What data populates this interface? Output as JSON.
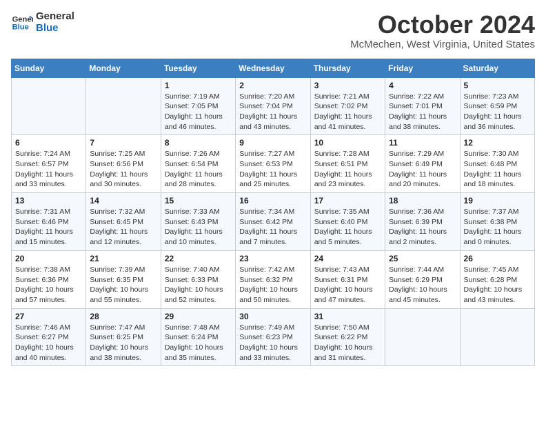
{
  "header": {
    "logo_line1": "General",
    "logo_line2": "Blue",
    "month": "October 2024",
    "location": "McMechen, West Virginia, United States"
  },
  "weekdays": [
    "Sunday",
    "Monday",
    "Tuesday",
    "Wednesday",
    "Thursday",
    "Friday",
    "Saturday"
  ],
  "weeks": [
    [
      {
        "day": "",
        "info": ""
      },
      {
        "day": "",
        "info": ""
      },
      {
        "day": "1",
        "info": "Sunrise: 7:19 AM\nSunset: 7:05 PM\nDaylight: 11 hours and 46 minutes."
      },
      {
        "day": "2",
        "info": "Sunrise: 7:20 AM\nSunset: 7:04 PM\nDaylight: 11 hours and 43 minutes."
      },
      {
        "day": "3",
        "info": "Sunrise: 7:21 AM\nSunset: 7:02 PM\nDaylight: 11 hours and 41 minutes."
      },
      {
        "day": "4",
        "info": "Sunrise: 7:22 AM\nSunset: 7:01 PM\nDaylight: 11 hours and 38 minutes."
      },
      {
        "day": "5",
        "info": "Sunrise: 7:23 AM\nSunset: 6:59 PM\nDaylight: 11 hours and 36 minutes."
      }
    ],
    [
      {
        "day": "6",
        "info": "Sunrise: 7:24 AM\nSunset: 6:57 PM\nDaylight: 11 hours and 33 minutes."
      },
      {
        "day": "7",
        "info": "Sunrise: 7:25 AM\nSunset: 6:56 PM\nDaylight: 11 hours and 30 minutes."
      },
      {
        "day": "8",
        "info": "Sunrise: 7:26 AM\nSunset: 6:54 PM\nDaylight: 11 hours and 28 minutes."
      },
      {
        "day": "9",
        "info": "Sunrise: 7:27 AM\nSunset: 6:53 PM\nDaylight: 11 hours and 25 minutes."
      },
      {
        "day": "10",
        "info": "Sunrise: 7:28 AM\nSunset: 6:51 PM\nDaylight: 11 hours and 23 minutes."
      },
      {
        "day": "11",
        "info": "Sunrise: 7:29 AM\nSunset: 6:49 PM\nDaylight: 11 hours and 20 minutes."
      },
      {
        "day": "12",
        "info": "Sunrise: 7:30 AM\nSunset: 6:48 PM\nDaylight: 11 hours and 18 minutes."
      }
    ],
    [
      {
        "day": "13",
        "info": "Sunrise: 7:31 AM\nSunset: 6:46 PM\nDaylight: 11 hours and 15 minutes."
      },
      {
        "day": "14",
        "info": "Sunrise: 7:32 AM\nSunset: 6:45 PM\nDaylight: 11 hours and 12 minutes."
      },
      {
        "day": "15",
        "info": "Sunrise: 7:33 AM\nSunset: 6:43 PM\nDaylight: 11 hours and 10 minutes."
      },
      {
        "day": "16",
        "info": "Sunrise: 7:34 AM\nSunset: 6:42 PM\nDaylight: 11 hours and 7 minutes."
      },
      {
        "day": "17",
        "info": "Sunrise: 7:35 AM\nSunset: 6:40 PM\nDaylight: 11 hours and 5 minutes."
      },
      {
        "day": "18",
        "info": "Sunrise: 7:36 AM\nSunset: 6:39 PM\nDaylight: 11 hours and 2 minutes."
      },
      {
        "day": "19",
        "info": "Sunrise: 7:37 AM\nSunset: 6:38 PM\nDaylight: 11 hours and 0 minutes."
      }
    ],
    [
      {
        "day": "20",
        "info": "Sunrise: 7:38 AM\nSunset: 6:36 PM\nDaylight: 10 hours and 57 minutes."
      },
      {
        "day": "21",
        "info": "Sunrise: 7:39 AM\nSunset: 6:35 PM\nDaylight: 10 hours and 55 minutes."
      },
      {
        "day": "22",
        "info": "Sunrise: 7:40 AM\nSunset: 6:33 PM\nDaylight: 10 hours and 52 minutes."
      },
      {
        "day": "23",
        "info": "Sunrise: 7:42 AM\nSunset: 6:32 PM\nDaylight: 10 hours and 50 minutes."
      },
      {
        "day": "24",
        "info": "Sunrise: 7:43 AM\nSunset: 6:31 PM\nDaylight: 10 hours and 47 minutes."
      },
      {
        "day": "25",
        "info": "Sunrise: 7:44 AM\nSunset: 6:29 PM\nDaylight: 10 hours and 45 minutes."
      },
      {
        "day": "26",
        "info": "Sunrise: 7:45 AM\nSunset: 6:28 PM\nDaylight: 10 hours and 43 minutes."
      }
    ],
    [
      {
        "day": "27",
        "info": "Sunrise: 7:46 AM\nSunset: 6:27 PM\nDaylight: 10 hours and 40 minutes."
      },
      {
        "day": "28",
        "info": "Sunrise: 7:47 AM\nSunset: 6:25 PM\nDaylight: 10 hours and 38 minutes."
      },
      {
        "day": "29",
        "info": "Sunrise: 7:48 AM\nSunset: 6:24 PM\nDaylight: 10 hours and 35 minutes."
      },
      {
        "day": "30",
        "info": "Sunrise: 7:49 AM\nSunset: 6:23 PM\nDaylight: 10 hours and 33 minutes."
      },
      {
        "day": "31",
        "info": "Sunrise: 7:50 AM\nSunset: 6:22 PM\nDaylight: 10 hours and 31 minutes."
      },
      {
        "day": "",
        "info": ""
      },
      {
        "day": "",
        "info": ""
      }
    ]
  ]
}
